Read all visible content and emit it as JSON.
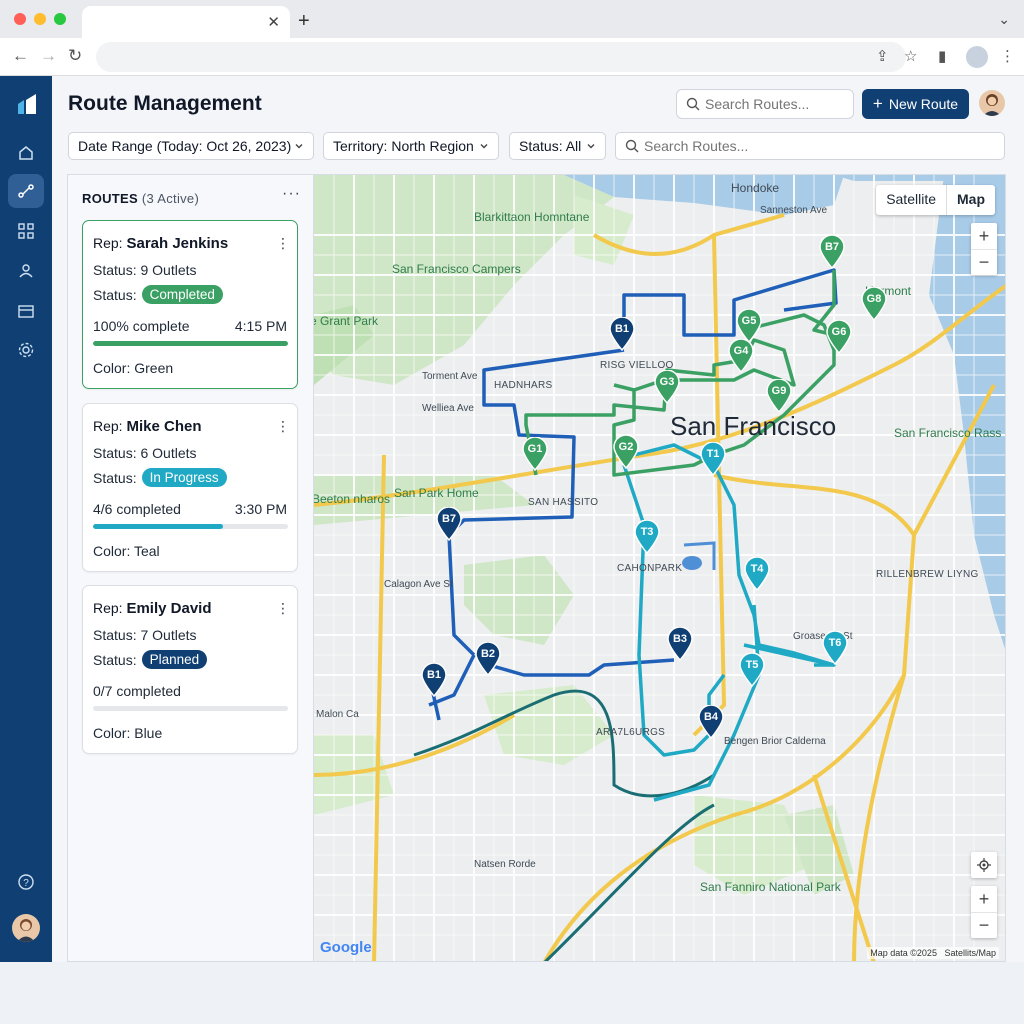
{
  "header": {
    "title": "Route Management",
    "search_placeholder": "Search Routes...",
    "new_route_label": "New Route"
  },
  "filters": {
    "date_range": "Date Range (Today: Oct 26, 2023)",
    "territory": "Territory: North Region",
    "status": "Status: All",
    "search_placeholder": "Search Routes..."
  },
  "routes_panel": {
    "title": "ROUTES",
    "active_count": "(3 Active)",
    "cards": [
      {
        "rep_prefix": "Rep:",
        "rep": "Sarah Jenkins",
        "outlets": "Status: 9 Outlets",
        "status_prefix": "Status:",
        "status": "Completed",
        "status_color": "#3aa063",
        "progress_text": "100% complete",
        "time": "4:15 PM",
        "progress": 1.0,
        "bar_color": "#3aa063",
        "color_text": "Color: Green"
      },
      {
        "rep_prefix": "Rep:",
        "rep": "Mike Chen",
        "outlets": "Status: 6 Outlets",
        "status_prefix": "Status:",
        "status": "In Progress",
        "status_color": "#1fa9c4",
        "progress_text": "4/6 completed",
        "time": "3:30 PM",
        "progress": 0.667,
        "bar_color": "#1fa9c4",
        "color_text": "Color: Teal"
      },
      {
        "rep_prefix": "Rep:",
        "rep": "Emily David",
        "outlets": "Status: 7 Outlets",
        "status_prefix": "Status:",
        "status": "Planned",
        "status_color": "#0f3f73",
        "progress_text": "0/7 completed",
        "time": "",
        "progress": 0.0,
        "bar_color": "#0f3f73",
        "color_text": "Color: Blue"
      }
    ]
  },
  "map": {
    "toggle_satellite": "Satellite",
    "toggle_map": "Map",
    "city_label": "San Francisco",
    "labels": {
      "hondoke": "Hondoke",
      "blarkittaon": "Blarkittaon Homntane",
      "sf_campers": "San Francisco Campers",
      "grant_park": "e Grant Park",
      "torment_ave": "Torment Ave",
      "wellea_ave": "Welliea Ave",
      "hadnhars": "HADNHARS",
      "risg": "RISG VIELLOO",
      "beeton": "Beeton nharos",
      "sp_home": "San Park Home",
      "san_hassito": "SAN HASSITO",
      "calagon": "Calagon Ave St",
      "cahonpark": "CAHONPARK",
      "rillenbrew": "RILLENBREW LIYNG",
      "grosserne": "Groaserne St",
      "aratsurgs": "ARA7L6URGS",
      "malon": "Malon Ca",
      "bengen": "Bengen Brior Calderna",
      "sf_rass": "San Francisco Rass",
      "hermont": "Hermont",
      "sannaston": "Sanneston Ave",
      "sf_national": "San Fanniro National Park",
      "natsen": "Natsen Rorde"
    },
    "pins": {
      "green": [
        "B7",
        "G8",
        "G5",
        "G4",
        "G6",
        "G3",
        "G9",
        "G2",
        "G1"
      ],
      "teal": [
        "T1",
        "T3",
        "T4",
        "T5",
        "T6"
      ],
      "blue": [
        "B1",
        "B7",
        "B2",
        "B1",
        "B3",
        "B4"
      ]
    },
    "attribution": "Map data ©2025",
    "attribution2": "Satellits/Map",
    "google": "Google"
  },
  "colors": {
    "brand": "#0f3f73",
    "green_route": "#3aa063",
    "teal_route": "#1fa9c4",
    "blue_route": "#1f5fb8"
  }
}
